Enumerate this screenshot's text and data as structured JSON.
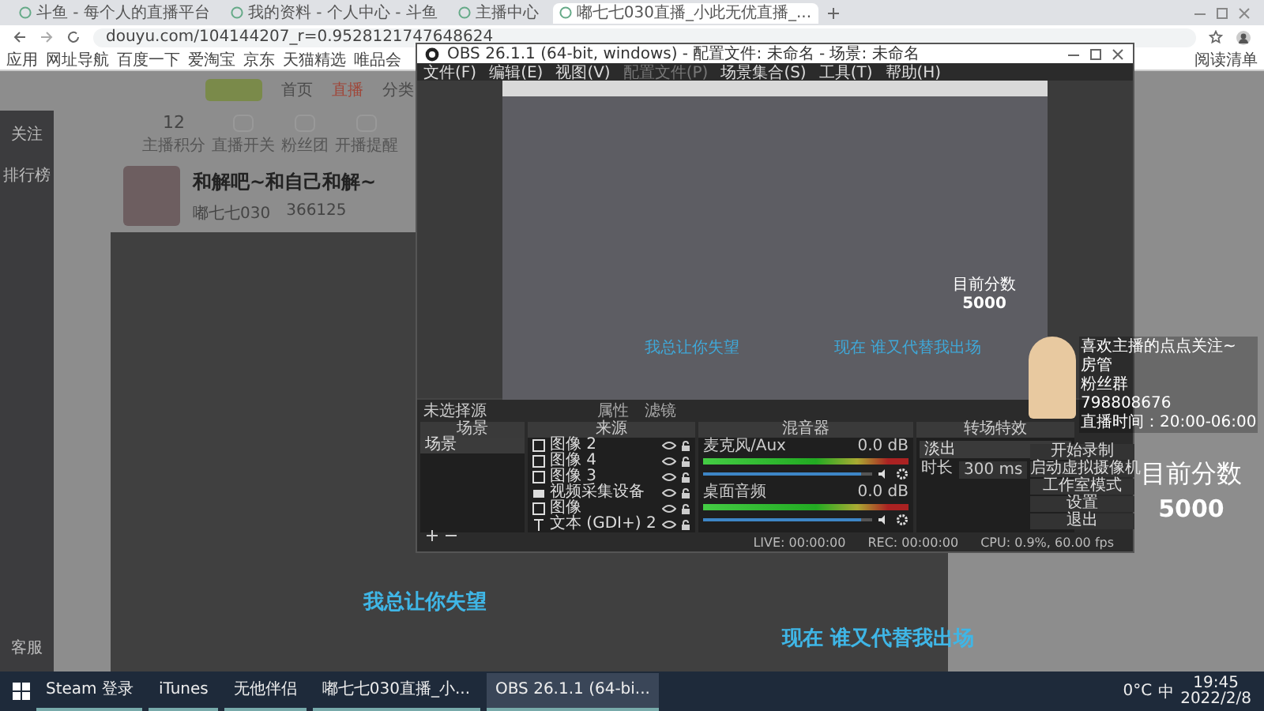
{
  "browser": {
    "tabs": [
      {
        "title": "斗鱼 - 每个人的直播平台",
        "selected": false
      },
      {
        "title": "我的资料 - 个人中心 - 斗鱼",
        "selected": false
      },
      {
        "title": "主播中心",
        "selected": false
      },
      {
        "title": "嘟七七030直播_小此无优直播_...",
        "selected": true
      }
    ],
    "address": "douyu.com/104144207_r=0.9528121747648624",
    "bookmarks": [
      "应用",
      "网址导航",
      "百度一下",
      "爱淘宝",
      "京东",
      "天猫精选",
      "唯品会"
    ],
    "reading_list": "阅读清单"
  },
  "page": {
    "nav": [
      "首页",
      "直播",
      "分类"
    ],
    "sidebar": [
      "关注",
      "排行榜"
    ],
    "sidebar_bottom": "客服",
    "stats": [
      {
        "value": "12",
        "label": "主播积分"
      },
      {
        "label": "直播开关"
      },
      {
        "label": "粉丝团"
      },
      {
        "label": "开播提醒"
      }
    ],
    "room_title": "和解吧~和自己和解~",
    "streamer": "嘟七七030",
    "hot": "366125",
    "lyrics": [
      "我总让你失望",
      "现在  谁又代替我出场"
    ]
  },
  "obs": {
    "title": "OBS 26.1.1 (64-bit, windows) - 配置文件: 未命名 - 场景: 未命名",
    "menu": [
      {
        "label": "文件(F)",
        "disabled": false
      },
      {
        "label": "编辑(E)",
        "disabled": false
      },
      {
        "label": "视图(V)",
        "disabled": false
      },
      {
        "label": "配置文件(P)",
        "disabled": true
      },
      {
        "label": "场景集合(S)",
        "disabled": false
      },
      {
        "label": "工具(T)",
        "disabled": false
      },
      {
        "label": "帮助(H)",
        "disabled": false
      }
    ],
    "preview_texts": [
      "我总让你失望",
      "现在  谁又代替我出场",
      "目前分数",
      "5000"
    ],
    "no_source": "未选择源",
    "properties": "属性",
    "filters": "滤镜",
    "docks": [
      "场景",
      "来源",
      "混音器",
      "转场特效"
    ],
    "scenes": [
      {
        "name": "场景",
        "selected": true
      }
    ],
    "sources": [
      {
        "name": "图像 2",
        "kind": "image"
      },
      {
        "name": "图像 4",
        "kind": "image"
      },
      {
        "name": "图像 3",
        "kind": "image"
      },
      {
        "name": "视频采集设备",
        "kind": "camera"
      },
      {
        "name": "图像",
        "kind": "image"
      },
      {
        "name": "文本 (GDI+) 2",
        "kind": "text"
      }
    ],
    "mixer": [
      {
        "name": "麦克风/Aux",
        "db": "0.0 dB",
        "level": 0.93
      },
      {
        "name": "桌面音频",
        "db": "0.0 dB",
        "level": 0.93
      }
    ],
    "transition": "淡出",
    "duration_label": "时长",
    "duration": "300 ms",
    "controls": [
      "开始录制",
      "启动虚拟摄像机",
      "工作室模式",
      "设置",
      "退出"
    ],
    "status": [
      "LIVE: 00:00:00",
      "REC: 00:00:00",
      "CPU: 0.9%, 60.00 fps"
    ]
  },
  "overlay": {
    "lines": [
      "喜欢主播的点点关注~",
      "房管",
      "粉丝群",
      "798808676",
      "直播时间：20:00-06:00"
    ],
    "score_label": "目前分数",
    "score": "5000"
  },
  "taskbar": {
    "apps": [
      {
        "label": "Steam 登录",
        "selected": false
      },
      {
        "label": "iTunes",
        "selected": false
      },
      {
        "label": "无他伴侣",
        "selected": false
      },
      {
        "label": "嘟七七030直播_小...",
        "selected": false
      },
      {
        "label": "OBS 26.1.1 (64-bi...",
        "selected": true
      }
    ],
    "weather": "0°C",
    "ime": "中",
    "time": "19:45",
    "date": "2022/2/8"
  }
}
